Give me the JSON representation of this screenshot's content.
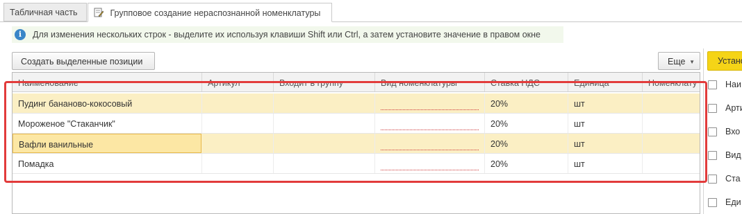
{
  "tabs": [
    {
      "label": "Табличная часть"
    },
    {
      "label": "Групповое создание нераспознанной номенклатуры",
      "icon": "edit-form-icon"
    }
  ],
  "info": {
    "icon": "info-icon",
    "text": "Для изменения нескольких строк - выделите их используя клавиши Shift или Ctrl, а затем установите значение в правом окне"
  },
  "toolbar": {
    "create_label": "Создать выделенные позиции",
    "more_label": "Еще",
    "set_label": "Устано"
  },
  "table": {
    "columns": [
      "Наименование",
      "Артикул",
      "Входит в группу",
      "Вид номенклатуры",
      "Ставка НДС",
      "Единица",
      "Номенклату"
    ],
    "rows": [
      {
        "name": "Пудинг бананово-кокосовый",
        "sku": "",
        "group": "",
        "kind": "",
        "vat": "20%",
        "unit": "шт",
        "nom": "",
        "selected": true
      },
      {
        "name": "Мороженое \"Стаканчик\"",
        "sku": "",
        "group": "",
        "kind": "",
        "vat": "20%",
        "unit": "шт",
        "nom": "",
        "selected": false
      },
      {
        "name": "Вафли ванильные",
        "sku": "",
        "group": "",
        "kind": "",
        "vat": "20%",
        "unit": "шт",
        "nom": "",
        "selected": true
      },
      {
        "name": "Помадка",
        "sku": "",
        "group": "",
        "kind": "",
        "vat": "20%",
        "unit": "шт",
        "nom": "",
        "selected": false
      }
    ]
  },
  "right_panel": {
    "checkboxes": [
      {
        "label": "Наи"
      },
      {
        "label": "Арти"
      },
      {
        "label": "Вхо"
      },
      {
        "label": "Вид"
      },
      {
        "label": "Ста"
      },
      {
        "label": "Еди"
      }
    ]
  },
  "colors": {
    "selected_row": "#fbefc4",
    "focused_cell": "#fce7a4",
    "highlight_frame": "#e23b3b",
    "primary_button": "#f5d417"
  }
}
